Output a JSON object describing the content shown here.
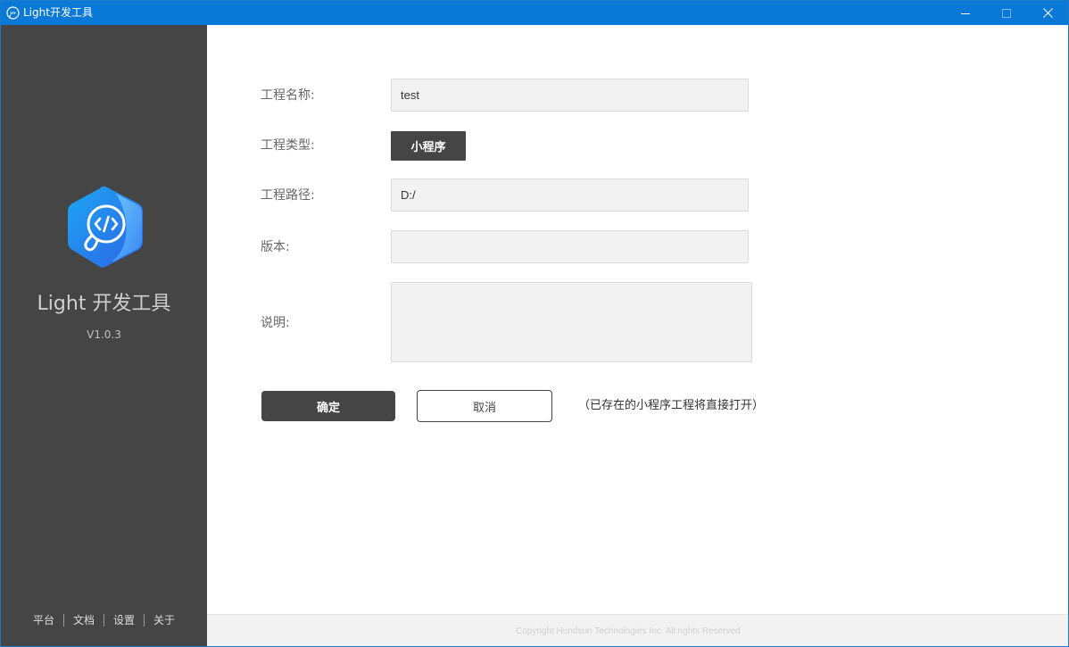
{
  "window": {
    "title": "Light开发工具",
    "accent_color": "#0a78d6"
  },
  "sidebar": {
    "app_name": "Light 开发工具",
    "version": "V1.0.3",
    "logo_icon": "code-link-logo-icon",
    "footer_items": [
      {
        "label": "平台"
      },
      {
        "label": "文档"
      },
      {
        "label": "设置"
      },
      {
        "label": "关于"
      }
    ],
    "background": "#454545"
  },
  "form": {
    "project_name": {
      "label": "工程名称:",
      "value": "test",
      "placeholder": ""
    },
    "project_type": {
      "label": "工程类型:",
      "selected": "小程序"
    },
    "project_path": {
      "label": "工程路径:",
      "value": "D:/",
      "placeholder": ""
    },
    "version": {
      "label": "版本:",
      "value": "",
      "placeholder": ""
    },
    "description": {
      "label": "说明:",
      "value": "",
      "placeholder": ""
    }
  },
  "actions": {
    "confirm_label": "确定",
    "cancel_label": "取消",
    "hint": "（已存在的小程序工程将直接打开）"
  },
  "footer": {
    "copyright": "Copyright Hundsun Technologies Inc. All rights Reserved"
  }
}
